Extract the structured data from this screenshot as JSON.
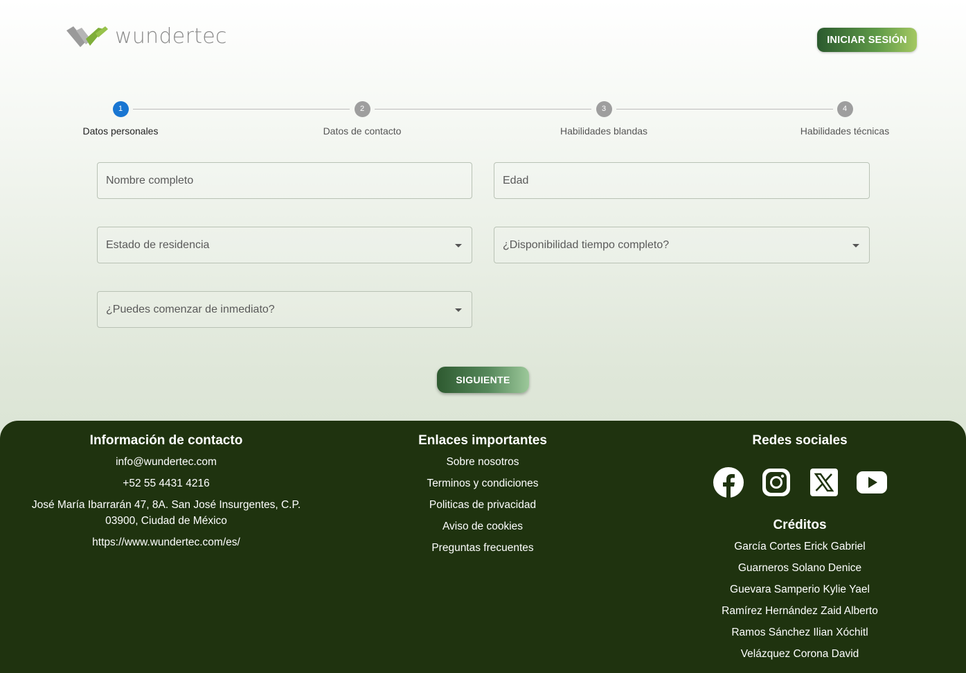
{
  "brand": {
    "name": "wundertec",
    "logo_colors": [
      "#9a9a9a",
      "#7fae3a"
    ]
  },
  "header": {
    "login_label": "INICIAR SESIÓN"
  },
  "stepper": {
    "steps": [
      {
        "number": "1",
        "label": "Datos personales",
        "active": true
      },
      {
        "number": "2",
        "label": "Datos de contacto",
        "active": false
      },
      {
        "number": "3",
        "label": "Habilidades blandas",
        "active": false
      },
      {
        "number": "4",
        "label": "Habilidades técnicas",
        "active": false
      }
    ]
  },
  "form": {
    "full_name": {
      "placeholder": "Nombre completo",
      "value": ""
    },
    "age": {
      "placeholder": "Edad",
      "value": ""
    },
    "state": {
      "placeholder": "Estado de residencia",
      "value": ""
    },
    "full_time": {
      "placeholder": "¿Disponibilidad tiempo completo?",
      "value": ""
    },
    "start_now": {
      "placeholder": "¿Puedes comenzar de inmediato?",
      "value": ""
    },
    "next_label": "SIGUIENTE"
  },
  "footer": {
    "contact": {
      "title": "Información de contacto",
      "email": "info@wundertec.com",
      "phone": "+52 55 4431 4216",
      "address_line1": "José María Ibarrarán 47, 8A. San José Insurgentes, C.P.",
      "address_line2": "03900, Ciudad de México",
      "website": "https://www.wundertec.com/es/"
    },
    "links": {
      "title": "Enlaces importantes",
      "items": [
        "Sobre nosotros",
        "Terminos y condiciones",
        "Politicas de privacidad",
        "Aviso de cookies",
        "Preguntas frecuentes"
      ]
    },
    "social": {
      "title": "Redes sociales",
      "icons": [
        "facebook-icon",
        "instagram-icon",
        "x-icon",
        "youtube-icon"
      ]
    },
    "credits": {
      "title": "Créditos",
      "names": [
        "García Cortes Erick Gabriel",
        "Guarneros Solano Denice",
        "Guevara Samperio Kylie Yael",
        "Ramírez Hernández Zaid Alberto",
        "Ramos Sánchez Ilian Xóchitl",
        "Velázquez Corona David"
      ]
    }
  },
  "colors": {
    "accent": "#1976d2",
    "footer_bg": "#1f330f",
    "button_green": "#2e5a30"
  }
}
